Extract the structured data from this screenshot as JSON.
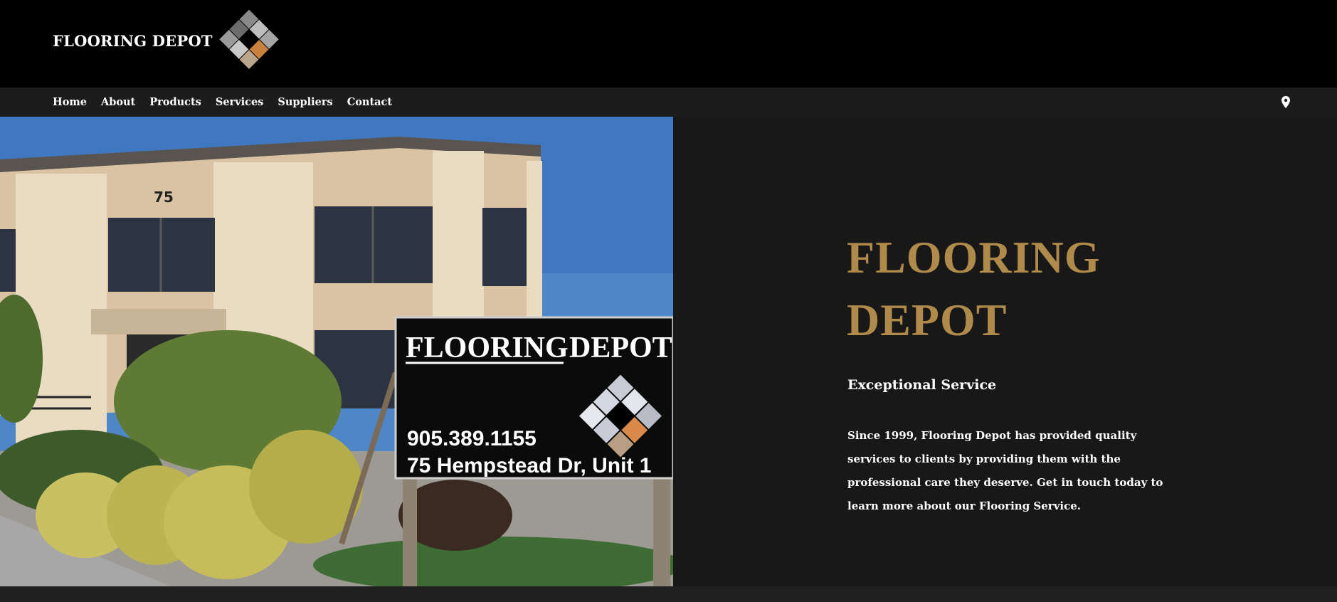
{
  "header": {
    "brand": "FLOORING DEPOT",
    "logo_icon": "diamond-tile-logo-icon"
  },
  "nav": {
    "items": [
      "Home",
      "About",
      "Products",
      "Services",
      "Suppliers",
      "Contact"
    ],
    "location_icon": "map-pin-icon"
  },
  "photo": {
    "building_number": "75",
    "sign_title_left": "FLOORING",
    "sign_title_right": "DEPOT",
    "sign_phone": "905.389.1155",
    "sign_address": "75 Hempstead Dr, Unit 1"
  },
  "hero": {
    "title_line1": "FLOORING",
    "title_line2": "DEPOT",
    "subtitle": "Exceptional Service",
    "body": "Since 1999, Flooring Depot has provided quality services to clients by providing them with the professional care they deserve. Get in touch today to learn more about our Flooring Service."
  },
  "colors": {
    "accent": "#b08a4a",
    "topbar": "#000000",
    "background": "#181818"
  }
}
